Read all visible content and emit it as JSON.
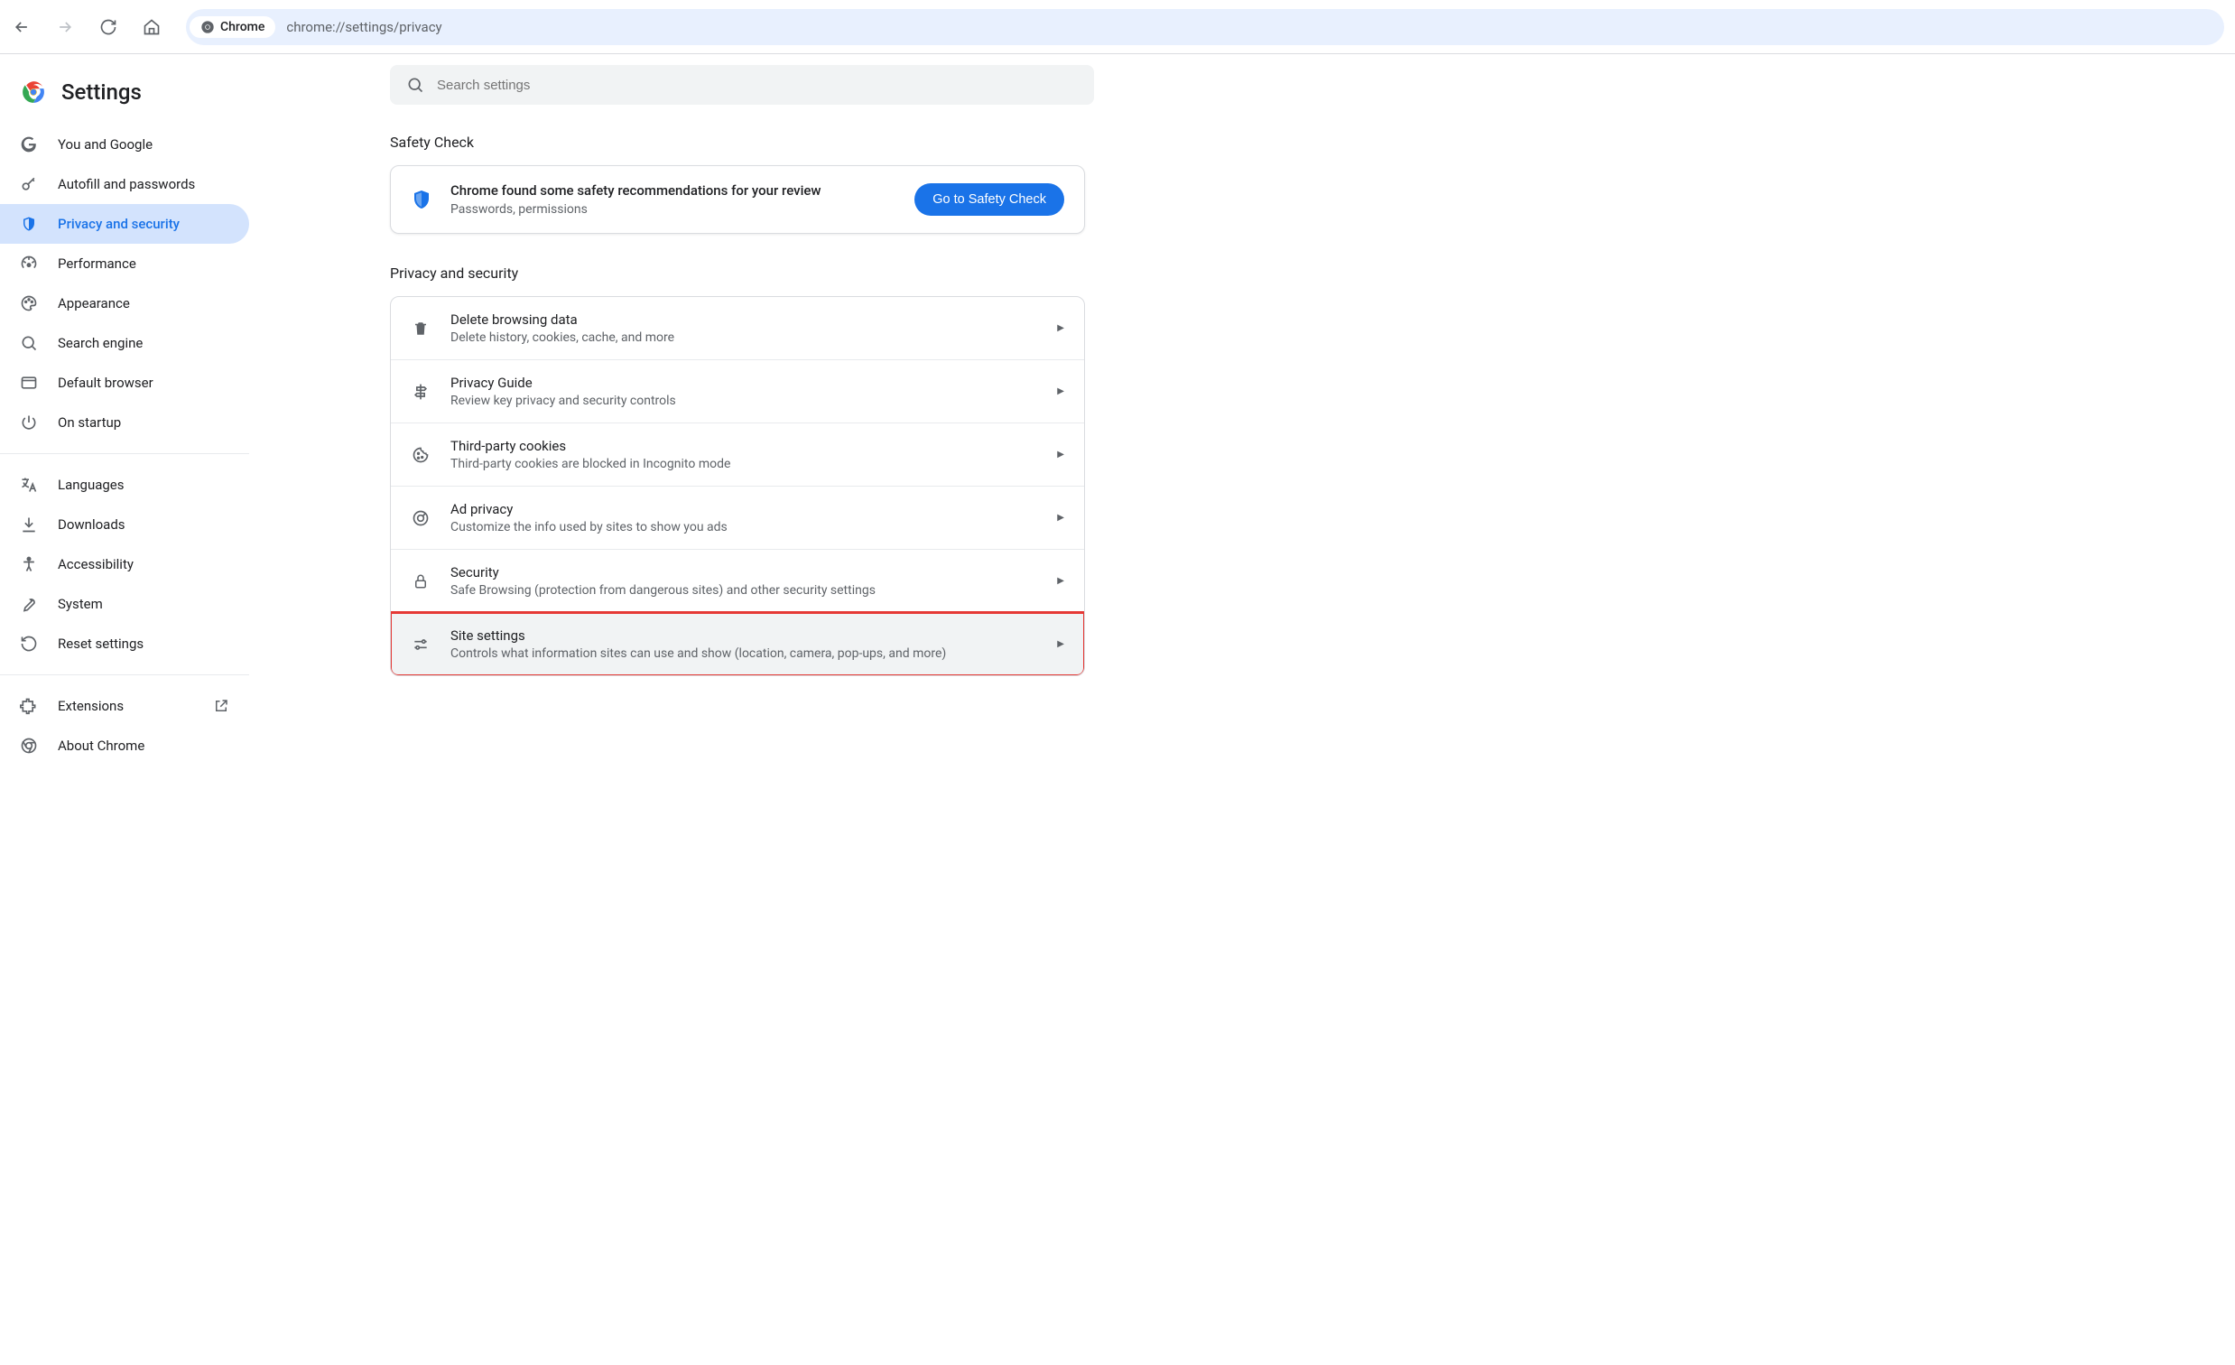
{
  "browser": {
    "site_chip": "Chrome",
    "url": "chrome://settings/privacy"
  },
  "sidebar": {
    "title": "Settings",
    "nav1": [
      {
        "label": "You and Google",
        "icon": "google"
      },
      {
        "label": "Autofill and passwords",
        "icon": "key"
      },
      {
        "label": "Privacy and security",
        "icon": "shield",
        "selected": true
      },
      {
        "label": "Performance",
        "icon": "speed"
      },
      {
        "label": "Appearance",
        "icon": "palette"
      },
      {
        "label": "Search engine",
        "icon": "search"
      },
      {
        "label": "Default browser",
        "icon": "browser"
      },
      {
        "label": "On startup",
        "icon": "power"
      }
    ],
    "nav2": [
      {
        "label": "Languages",
        "icon": "lang"
      },
      {
        "label": "Downloads",
        "icon": "download"
      },
      {
        "label": "Accessibility",
        "icon": "accessibility"
      },
      {
        "label": "System",
        "icon": "wrench"
      },
      {
        "label": "Reset settings",
        "icon": "reset"
      }
    ],
    "nav3": [
      {
        "label": "Extensions",
        "icon": "extension",
        "launch": true
      },
      {
        "label": "About Chrome",
        "icon": "chrome"
      }
    ]
  },
  "main": {
    "search_placeholder": "Search settings",
    "safety": {
      "heading": "Safety Check",
      "title": "Chrome found some safety recommendations for your review",
      "subtitle": "Passwords, permissions",
      "button": "Go to Safety Check"
    },
    "privacy": {
      "heading": "Privacy and security",
      "rows": [
        {
          "icon": "trash",
          "title": "Delete browsing data",
          "sub": "Delete history, cookies, cache, and more"
        },
        {
          "icon": "signpost",
          "title": "Privacy Guide",
          "sub": "Review key privacy and security controls"
        },
        {
          "icon": "cookie",
          "title": "Third-party cookies",
          "sub": "Third-party cookies are blocked in Incognito mode"
        },
        {
          "icon": "adprivacy",
          "title": "Ad privacy",
          "sub": "Customize the info used by sites to show you ads"
        },
        {
          "icon": "lock",
          "title": "Security",
          "sub": "Safe Browsing (protection from dangerous sites) and other security settings"
        },
        {
          "icon": "sliders",
          "title": "Site settings",
          "sub": "Controls what information sites can use and show (location, camera, pop-ups, and more)",
          "highlighted": true
        }
      ]
    }
  }
}
